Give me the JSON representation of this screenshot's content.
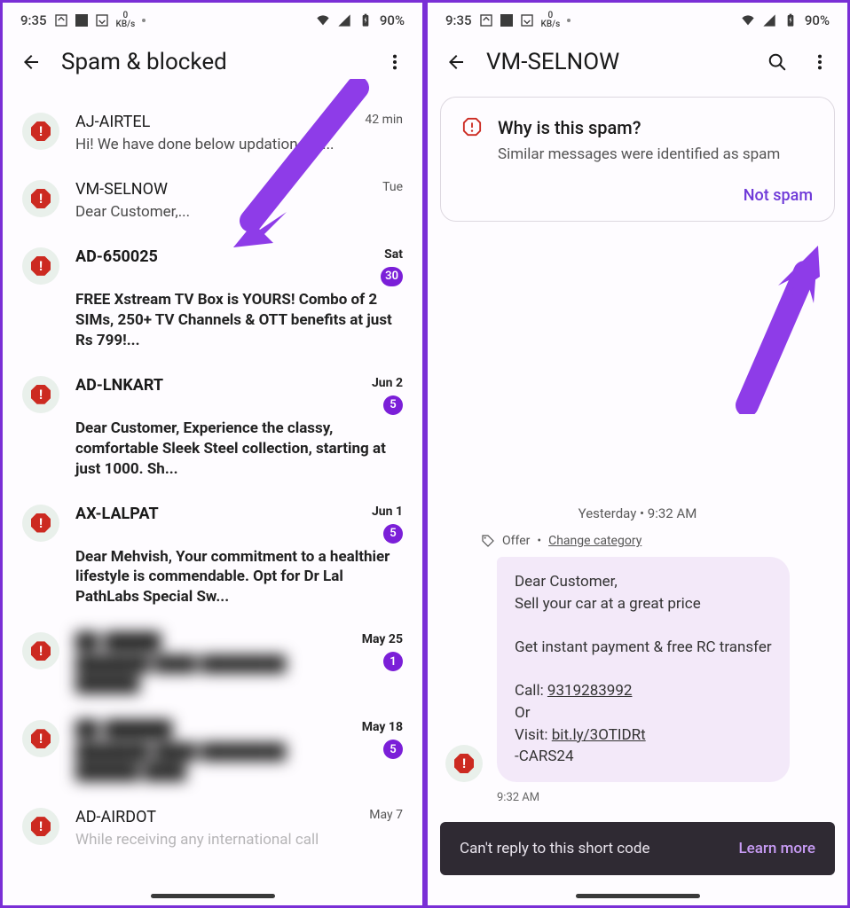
{
  "status": {
    "time": "9:35",
    "net_top": "0",
    "net_bot": "KB/s",
    "battery": "90%"
  },
  "left": {
    "title": "Spam & blocked",
    "items": [
      {
        "sender": "AJ-AIRTEL",
        "time": "42 min",
        "preview": "Hi! We have done below updation on ...",
        "bold": false,
        "badge": ""
      },
      {
        "sender": "VM-SELNOW",
        "time": "Tue",
        "preview": "Dear Customer,...",
        "bold": false,
        "badge": ""
      },
      {
        "sender": "AD-650025",
        "time": "Sat",
        "preview": "FREE Xstream TV Box is YOURS! Combo of 2 SIMs, 250+ TV Channels & OTT benefits at just Rs 799!...",
        "bold": true,
        "badge": "30"
      },
      {
        "sender": "AD-LNKART",
        "time": "Jun 2",
        "preview": "Dear Customer, Experience the classy, comfortable Sleek Steel collection, starting at just 1000. Sh...",
        "bold": true,
        "badge": "5"
      },
      {
        "sender": "AX-LALPAT",
        "time": "Jun 1",
        "preview": "Dear Mehvish, Your commitment to a healthier lifestyle is commendable. Opt for Dr Lal PathLabs Special Sw...",
        "bold": true,
        "badge": "5"
      },
      {
        "sender": "██-█████",
        "time": "May 25",
        "preview": "███████ ████ ████████ ██████",
        "bold": true,
        "badge": "1",
        "blurred": true
      },
      {
        "sender": "██-██████",
        "time": "May 18",
        "preview": "███████ ████ ████████ ██████ ████",
        "bold": true,
        "badge": "5",
        "blurred": true
      },
      {
        "sender": "AD-AIRDOT",
        "time": "May 7",
        "preview": "While receiving any international call",
        "bold": false,
        "badge": ""
      }
    ]
  },
  "right": {
    "title": "VM-SELNOW",
    "card": {
      "title": "Why is this spam?",
      "desc": "Similar messages were identified as spam",
      "action": "Not spam"
    },
    "timestamp": "Yesterday • 9:32 AM",
    "category_label": "Offer",
    "category_action": "Change category",
    "message": {
      "l1": "Dear Customer,",
      "l2": "Sell your car at a great price",
      "l3": "Get instant payment & free RC transfer",
      "l4a": "Call: ",
      "l4b": "9319283992",
      "l5": "Or",
      "l6a": "Visit: ",
      "l6b": "bit.ly/3OTIDRt",
      "l7": "-CARS24",
      "time": "9:32 AM"
    },
    "banner": {
      "text": "Can't reply to this short code",
      "action": "Learn more"
    }
  }
}
